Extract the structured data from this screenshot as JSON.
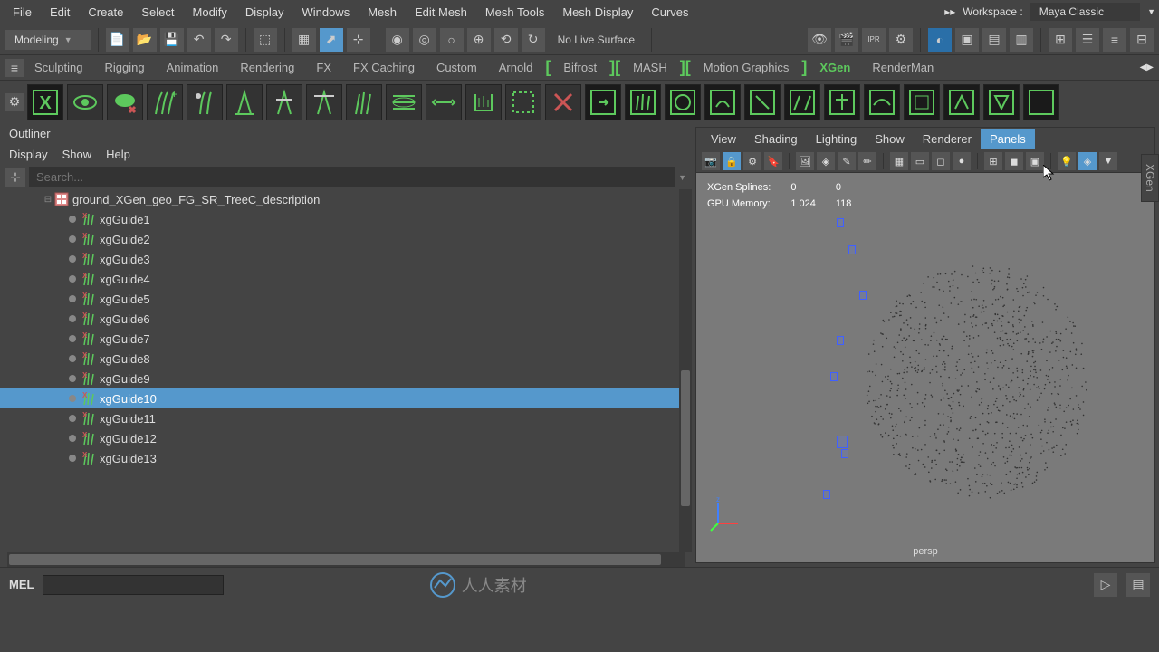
{
  "menubar": [
    "File",
    "Edit",
    "Create",
    "Select",
    "Modify",
    "Display",
    "Windows",
    "Mesh",
    "Edit Mesh",
    "Mesh Tools",
    "Mesh Display",
    "Curves"
  ],
  "workspace": {
    "label": "Workspace :",
    "name": "Maya Classic"
  },
  "mode": "Modeling",
  "live_surface": "No Live Surface",
  "shelves": [
    "Sculpting",
    "Rigging",
    "Animation",
    "Rendering",
    "FX",
    "FX Caching",
    "Custom",
    "Arnold",
    "Bifrost",
    "MASH",
    "Motion Graphics",
    "XGen",
    "RenderMan"
  ],
  "active_shelf": "XGen",
  "outliner": {
    "title": "Outliner",
    "menus": [
      "Display",
      "Show",
      "Help"
    ],
    "search_placeholder": "Search...",
    "parent_node": "ground_XGen_geo_FG_SR_TreeC_description",
    "children": [
      "xgGuide1",
      "xgGuide2",
      "xgGuide3",
      "xgGuide4",
      "xgGuide5",
      "xgGuide6",
      "xgGuide7",
      "xgGuide8",
      "xgGuide9",
      "xgGuide10",
      "xgGuide11",
      "xgGuide12",
      "xgGuide13"
    ],
    "selected": "xgGuide10"
  },
  "viewport": {
    "menus": [
      "View",
      "Shading",
      "Lighting",
      "Show",
      "Renderer",
      "Panels"
    ],
    "highlighted_menu": "Panels",
    "stats": {
      "row1_label": "XGen Splines:",
      "row1_val1": "0",
      "row1_val2": "0",
      "row2_label": "GPU Memory:",
      "row2_val1": "1 024",
      "row2_val2": "118"
    },
    "camera": "persp"
  },
  "right_tab": "XGen",
  "mel": "MEL",
  "watermark": "人人素材"
}
